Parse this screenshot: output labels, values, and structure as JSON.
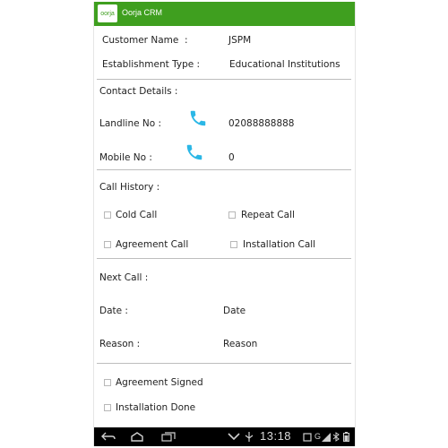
{
  "app": {
    "title": "Oorja CRM",
    "logo_text": "oorja"
  },
  "customer": {
    "name_label": "Customer Name",
    "name_colon": ":",
    "name_value": "JSPM",
    "establishment_label": "Establishment Type :",
    "establishment_value": "Educational Institutions"
  },
  "contact": {
    "heading": "Contact Details :",
    "landline_label": "Landline No :",
    "landline_value": "02088888888",
    "mobile_label": "Mobile No  :",
    "mobile_value": "0"
  },
  "call_history": {
    "heading": "Call History :",
    "options": [
      "Cold Call",
      "Repeat Call",
      "Agreement Call",
      "Installation Call"
    ]
  },
  "next_call": {
    "heading": "Next Call :",
    "date_label": "Date :",
    "date_value": "Date",
    "reason_label": "Reason :",
    "reason_value": "Reason"
  },
  "status": {
    "options": [
      "Agreement Signed",
      "Installation Done"
    ]
  },
  "system_bar": {
    "time": "13:18",
    "network": "G"
  },
  "colors": {
    "title_bar": "#3f9f1f",
    "phone_icon": "#2bb7e6"
  },
  "icons": {
    "phone": "phone-icon",
    "back": "back-icon",
    "home": "home-icon",
    "recent": "recent-apps-icon"
  }
}
